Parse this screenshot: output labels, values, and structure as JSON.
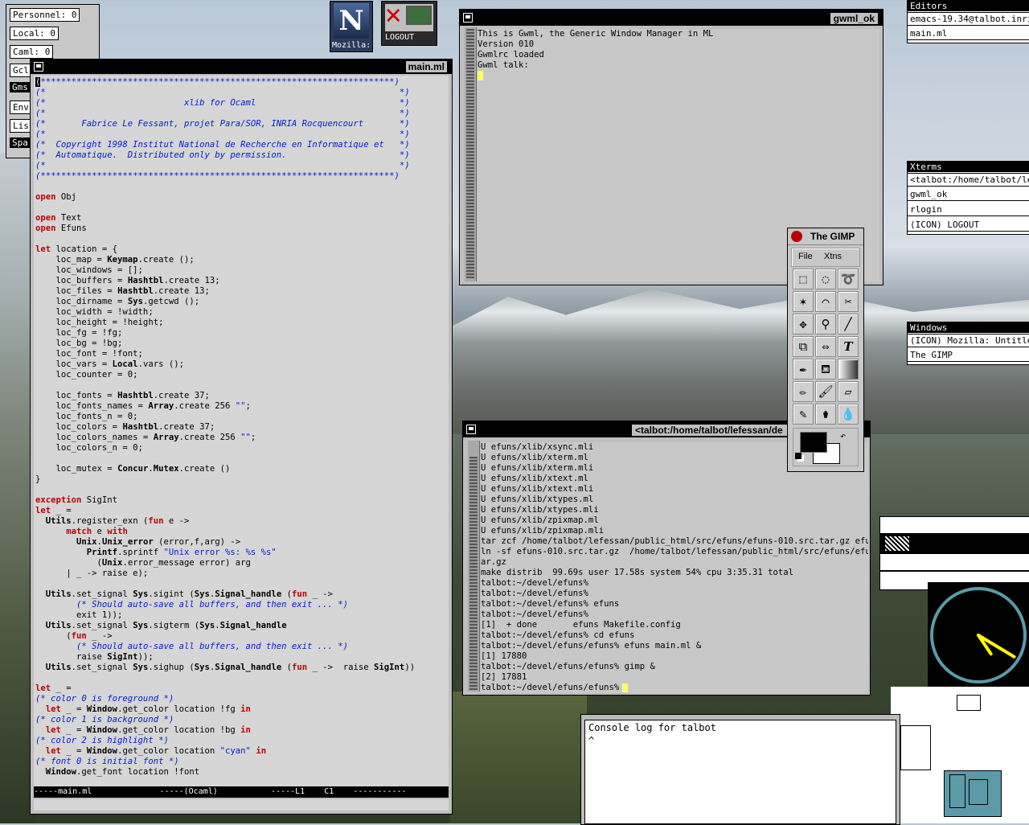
{
  "top_panel": {
    "personnel": "Personnel: 0",
    "local": "Local: 0",
    "caml": "Caml: 0",
    "cut_items": [
      "Gcl",
      "Gms",
      "Env",
      "Lis",
      "Spa"
    ]
  },
  "icons": {
    "mozilla_label": "Mozilla:",
    "logout_label": "LOGOUT"
  },
  "emacs": {
    "title": "main.ml",
    "modeline": "-----main.ml              -----(Ocaml)           -----L1    C1    -----------"
  },
  "gwml": {
    "title": "gwml_ok",
    "lines": [
      "This is Gwml, the Generic Window Manager in ML",
      "Version 010",
      "Gwmlrc loaded",
      "Gwml talk:"
    ]
  },
  "xterm": {
    "title": "<talbot:/home/talbot/lefessan/de",
    "lines": [
      "U efuns/xlib/xsync.mli",
      "U efuns/xlib/xterm.ml",
      "U efuns/xlib/xterm.mli",
      "U efuns/xlib/xtext.ml",
      "U efuns/xlib/xtext.mli",
      "U efuns/xlib/xtypes.ml",
      "U efuns/xlib/xtypes.mli",
      "U efuns/xlib/zpixmap.ml",
      "U efuns/xlib/zpixmap.mli",
      "tar zcf /home/talbot/lefessan/public_html/src/efuns/efuns-010.src.tar.gz efuns",
      "ln -sf efuns-010.src.tar.gz  /home/talbot/lefessan/public_html/src/efuns/efuns.t",
      "ar.gz",
      "make distrib  99.69s user 17.58s system 54% cpu 3:35.31 total",
      "talbot:~/devel/efuns%",
      "talbot:~/devel/efuns%",
      "talbot:~/devel/efuns% efuns",
      "talbot:~/devel/efuns%",
      "[1]  + done       efuns Makefile.config",
      "talbot:~/devel/efuns% cd efuns",
      "talbot:~/devel/efuns/efuns% efuns main.ml &",
      "[1] 17880",
      "talbot:~/devel/efuns/efuns% gimp &",
      "[2] 17881",
      "talbot:~/devel/efuns/efuns%"
    ]
  },
  "gimp": {
    "title": "The GIMP",
    "menu": [
      "File",
      "Xtns"
    ]
  },
  "editors_menu": {
    "header": "Editors",
    "items": [
      "emacs-19.34@talbot.inria.",
      "main.ml"
    ]
  },
  "xterms_menu": {
    "header": "Xterms",
    "items": [
      "<talbot:/home/talbot/lefe",
      "gwml_ok",
      "rlogin",
      "(ICON) LOGOUT"
    ]
  },
  "windows_menu": {
    "header": "Windows",
    "items": [
      "(ICON) Mozilla: Untitled",
      "The GIMP"
    ]
  },
  "console": {
    "text": "Console log for talbot",
    "cursor": "^"
  },
  "clock": {
    "hour_angle_deg": 146,
    "minute_angle_deg": 121
  },
  "colors": {
    "title_bar": "#000000",
    "keyword": "#c00000",
    "comment": "#0020d0",
    "window_bg": "#bfbfbf",
    "clock_face": "#5c9aa8"
  }
}
